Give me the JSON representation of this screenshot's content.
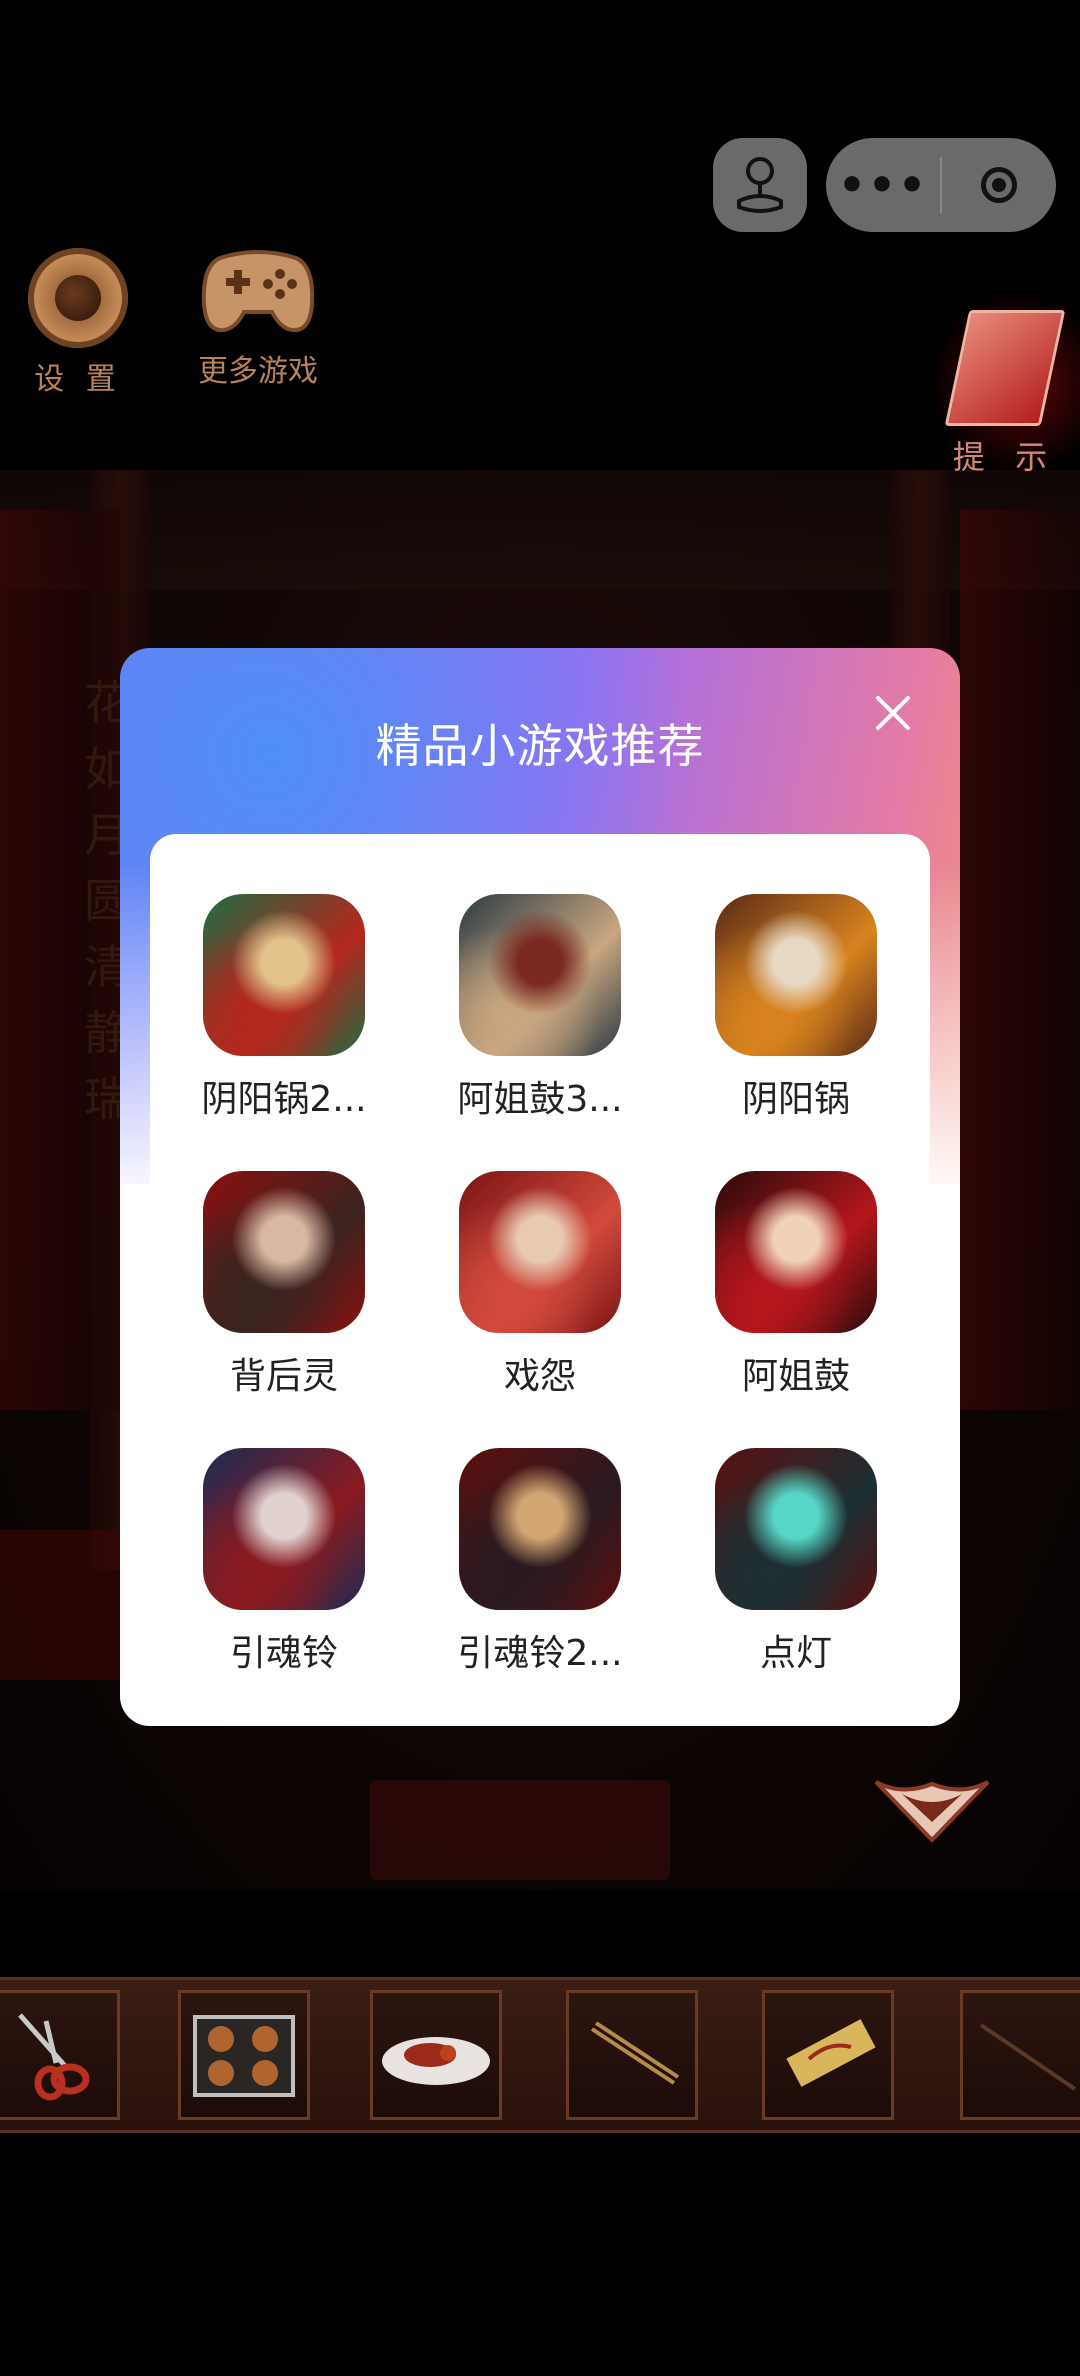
{
  "hud": {
    "settings_label": "设 置",
    "more_games_label": "更多游戏",
    "hint_label": "提 示"
  },
  "capsule": {
    "more_label": "•••"
  },
  "background": {
    "vertical_text": "花如月圆清静瑞"
  },
  "modal": {
    "title": "精品小游戏推荐",
    "games": [
      {
        "name": "阴阳锅2...",
        "icon": "hotpot-icon",
        "colors": [
          "#1f6b43",
          "#b5271d",
          "#e3c28b"
        ]
      },
      {
        "name": "阿姐鼓3...",
        "icon": "girl-portrait-icon",
        "colors": [
          "#2b3a44",
          "#c9a67f",
          "#7b2a22"
        ]
      },
      {
        "name": "阴阳锅",
        "icon": "hotpot-icon",
        "colors": [
          "#5a2a16",
          "#d8831f",
          "#e8d9c4"
        ]
      },
      {
        "name": "背后灵",
        "icon": "ghost-pair-icon",
        "colors": [
          "#8b1010",
          "#3a2420",
          "#d9b7a2"
        ]
      },
      {
        "name": "戏怨",
        "icon": "opera-mask-icon",
        "colors": [
          "#7a1416",
          "#d24a3c",
          "#e8c9b2"
        ]
      },
      {
        "name": "阿姐鼓",
        "icon": "drum-poster-icon",
        "colors": [
          "#2a0b0b",
          "#b5161c",
          "#f0d2b8"
        ]
      },
      {
        "name": "引魂铃",
        "icon": "veiled-bride-icon",
        "colors": [
          "#1d2b53",
          "#8a1a20",
          "#e1d2cf"
        ]
      },
      {
        "name": "引魂铃2...",
        "icon": "man-with-bell-icon",
        "colors": [
          "#5c0f0f",
          "#2a1a20",
          "#d2a673"
        ]
      },
      {
        "name": "点灯",
        "icon": "lamp-hands-icon",
        "colors": [
          "#5a1010",
          "#1c2f33",
          "#56d6c6"
        ]
      }
    ]
  }
}
